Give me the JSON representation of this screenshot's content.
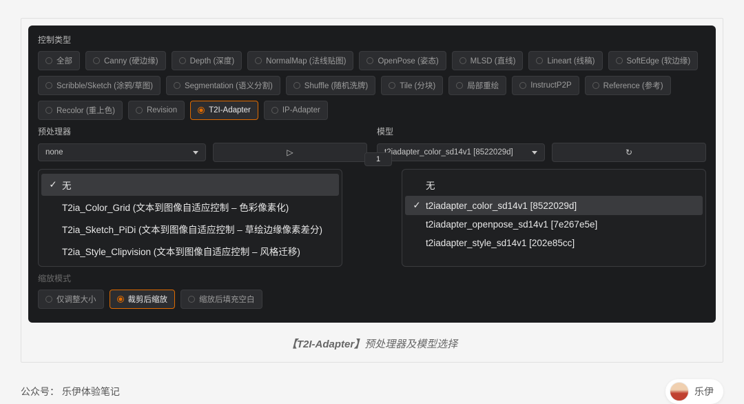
{
  "panel": {
    "section_label": "控制类型",
    "types": [
      {
        "label": "全部"
      },
      {
        "label": "Canny (硬边缘)"
      },
      {
        "label": "Depth (深度)"
      },
      {
        "label": "NormalMap (法线贴图)"
      },
      {
        "label": "OpenPose (姿态)"
      },
      {
        "label": "MLSD (直线)"
      },
      {
        "label": "Lineart (线稿)"
      },
      {
        "label": "SoftEdge (软边缘)"
      },
      {
        "label": "Scribble/Sketch (涂鸦/草图)"
      },
      {
        "label": "Segmentation (语义分割)"
      },
      {
        "label": "Shuffle (随机洗牌)"
      },
      {
        "label": "Tile (分块)"
      },
      {
        "label": "局部重绘"
      },
      {
        "label": "InstructP2P"
      },
      {
        "label": "Reference (参考)"
      },
      {
        "label": "Recolor (重上色)"
      },
      {
        "label": "Revision"
      },
      {
        "label": "T2I-Adapter",
        "selected": true
      },
      {
        "label": "IP-Adapter"
      }
    ],
    "preproc_label": "预处理器",
    "preproc_value": "none",
    "preproc_menu": [
      {
        "label": "无",
        "selected": true
      },
      {
        "label": "T2ia_Color_Grid (文本到图像自适应控制 – 色彩像素化)"
      },
      {
        "label": "T2ia_Sketch_PiDi (文本到图像自适应控制 – 草绘边缘像素差分)"
      },
      {
        "label": "T2ia_Style_Clipvision (文本到图像自适应控制 – 风格迁移)"
      }
    ],
    "model_label": "模型",
    "model_value": "t2iadapter_color_sd14v1 [8522029d]",
    "model_menu": [
      {
        "label": "无"
      },
      {
        "label": "t2iadapter_color_sd14v1 [8522029d]",
        "selected": true
      },
      {
        "label": "t2iadapter_openpose_sd14v1 [7e267e5e]"
      },
      {
        "label": "t2iadapter_style_sd14v1 [202e85cc]"
      }
    ],
    "num_value": "1",
    "scale_label": "缩放模式",
    "scale_opts": [
      {
        "label": "仅调整大小"
      },
      {
        "label": "裁剪后缩放",
        "selected": true
      },
      {
        "label": "缩放后填充空白"
      }
    ]
  },
  "caption": {
    "brand": "【T2I-Adapter】",
    "rest": "预处理器及模型选择"
  },
  "footer": {
    "prefix": "公众号：",
    "account": "乐伊体验笔记",
    "author": "乐伊"
  }
}
